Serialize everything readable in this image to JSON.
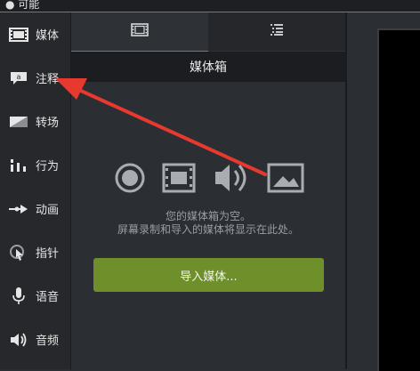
{
  "window": {
    "title": "● 可能"
  },
  "sidebar": {
    "items": [
      {
        "label": "媒体",
        "icon": "film-strip-icon"
      },
      {
        "label": "注释",
        "icon": "annotation-icon"
      },
      {
        "label": "转场",
        "icon": "transition-icon"
      },
      {
        "label": "行为",
        "icon": "behavior-icon"
      },
      {
        "label": "动画",
        "icon": "animation-icon"
      },
      {
        "label": "指针",
        "icon": "cursor-icon"
      },
      {
        "label": "语音",
        "icon": "microphone-icon"
      },
      {
        "label": "音频",
        "icon": "audio-icon"
      }
    ]
  },
  "tabs": [
    {
      "icon": "film-strip-icon",
      "active": true
    },
    {
      "icon": "list-view-icon",
      "active": false
    }
  ],
  "panel": {
    "title": "媒体箱",
    "empty_line1": "您的媒体箱为空。",
    "empty_line2": "屏幕录制和导入的媒体将显示在此处。",
    "import_button": "导入媒体..."
  },
  "media_type_icons": [
    "record-icon",
    "video-icon",
    "audio-icon",
    "image-icon"
  ],
  "colors": {
    "accent": "#6f8f2a",
    "annotation_arrow": "#e8392f"
  }
}
